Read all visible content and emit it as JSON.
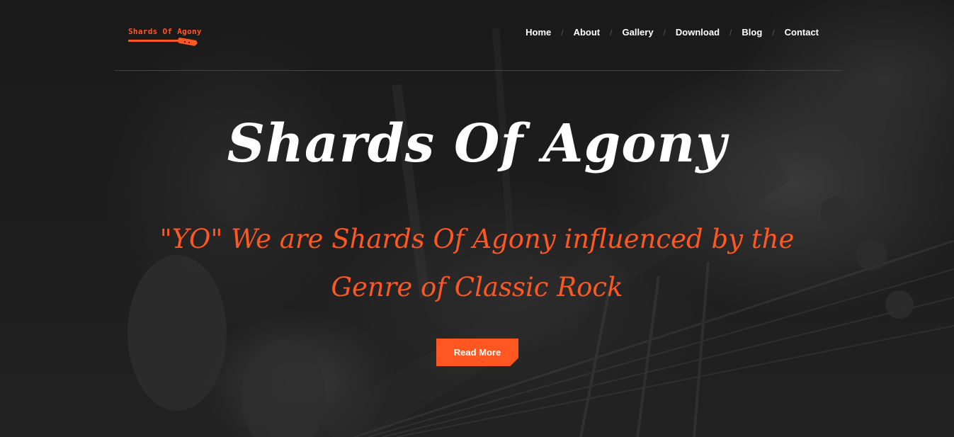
{
  "brand": {
    "logo_text": "Shards Of Agony",
    "accent_color": "#ff5722",
    "logo_icon": "guitar-icon"
  },
  "nav": {
    "items": [
      {
        "label": "Home"
      },
      {
        "label": "About"
      },
      {
        "label": "Gallery"
      },
      {
        "label": "Download"
      },
      {
        "label": "Blog"
      },
      {
        "label": "Contact"
      }
    ],
    "separator": "/"
  },
  "hero": {
    "title": "Shards Of Agony",
    "subtitle": "\"YO\" We are Shards Of Agony influenced by the Genre of Classic Rock",
    "button_label": "Read More"
  }
}
